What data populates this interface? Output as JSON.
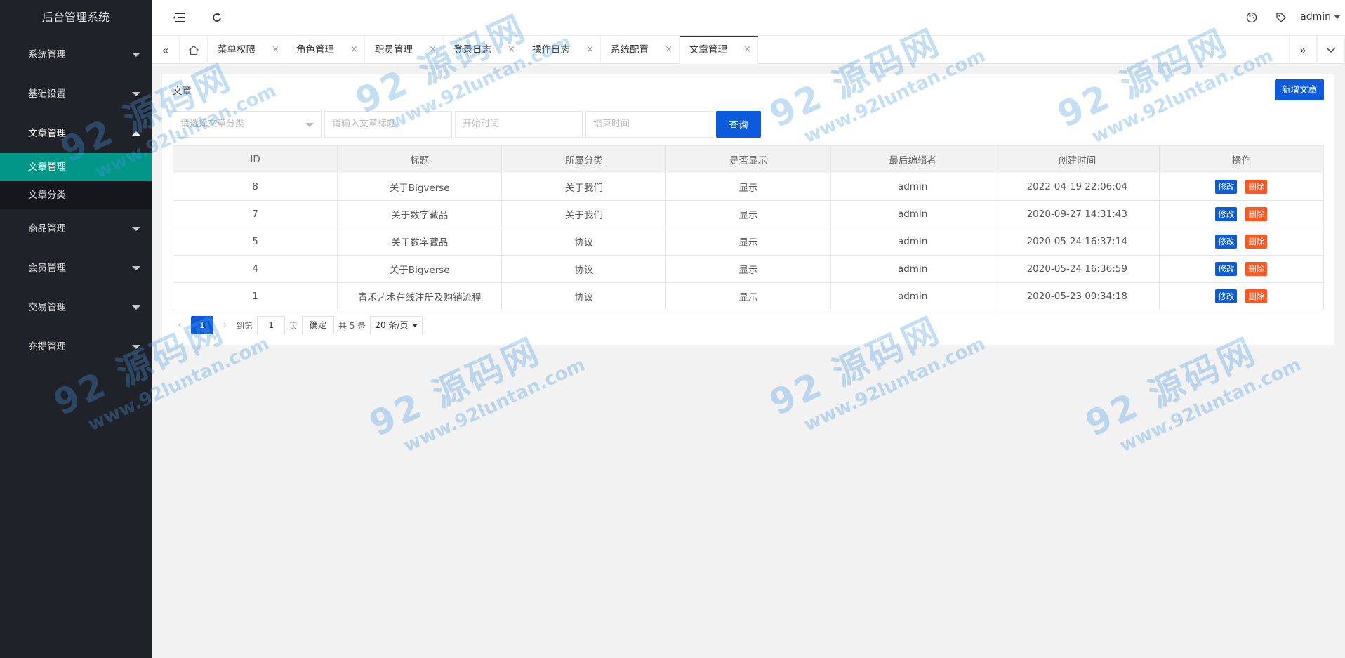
{
  "app": {
    "title": "后台管理系统"
  },
  "sidebar": {
    "items": [
      {
        "label": "系统管理"
      },
      {
        "label": "基础设置"
      },
      {
        "label": "文章管理",
        "open": true,
        "children": [
          "文章管理",
          "文章分类"
        ]
      },
      {
        "label": "商品管理"
      },
      {
        "label": "会员管理"
      },
      {
        "label": "交易管理"
      },
      {
        "label": "充提管理"
      }
    ]
  },
  "header": {
    "user": "admin"
  },
  "tabs": {
    "items": [
      "菜单权限",
      "角色管理",
      "职员管理",
      "登录日志",
      "操作日志",
      "系统配置",
      "文章管理"
    ],
    "close": "×",
    "active_index": 6
  },
  "card": {
    "title": "文章",
    "add_button": "新增文章"
  },
  "filters": {
    "category_placeholder": "请选择文章分类",
    "title_placeholder": "请输入文章标题",
    "start_placeholder": "开始时间",
    "end_placeholder": "结束时间",
    "query_button": "查询"
  },
  "table": {
    "columns": [
      "ID",
      "标题",
      "所属分类",
      "是否显示",
      "最后编辑者",
      "创建时间",
      "操作"
    ],
    "rows": [
      {
        "id": "8",
        "title": "关于Bigverse",
        "category": "关于我们",
        "show": "显示",
        "editor": "admin",
        "created": "2022-04-19 22:06:04"
      },
      {
        "id": "7",
        "title": "关于数字藏品",
        "category": "关于我们",
        "show": "显示",
        "editor": "admin",
        "created": "2020-09-27 14:31:43"
      },
      {
        "id": "5",
        "title": "关于数字藏品",
        "category": "协议",
        "show": "显示",
        "editor": "admin",
        "created": "2020-05-24 16:37:14"
      },
      {
        "id": "4",
        "title": "关于Bigverse",
        "category": "协议",
        "show": "显示",
        "editor": "admin",
        "created": "2020-05-24 16:36:59"
      },
      {
        "id": "1",
        "title": "青禾艺术在线注册及购销流程",
        "category": "协议",
        "show": "显示",
        "editor": "admin",
        "created": "2020-05-23 09:34:18"
      }
    ],
    "edit_label": "修改",
    "delete_label": "删除"
  },
  "pager": {
    "prev": "‹",
    "next": "›",
    "current": "1",
    "goto_label": "到第",
    "page_input": "1",
    "page_label": "页",
    "confirm": "确定",
    "total": "共 5 条",
    "page_size": "20 条/页"
  },
  "watermark": {
    "big": "92 源码网",
    "small": "www.92luntan.com"
  },
  "colors": {
    "sidebar": "#20222a",
    "active": "#009688",
    "primary": "#0c5bdc",
    "danger": "#ff5722"
  }
}
